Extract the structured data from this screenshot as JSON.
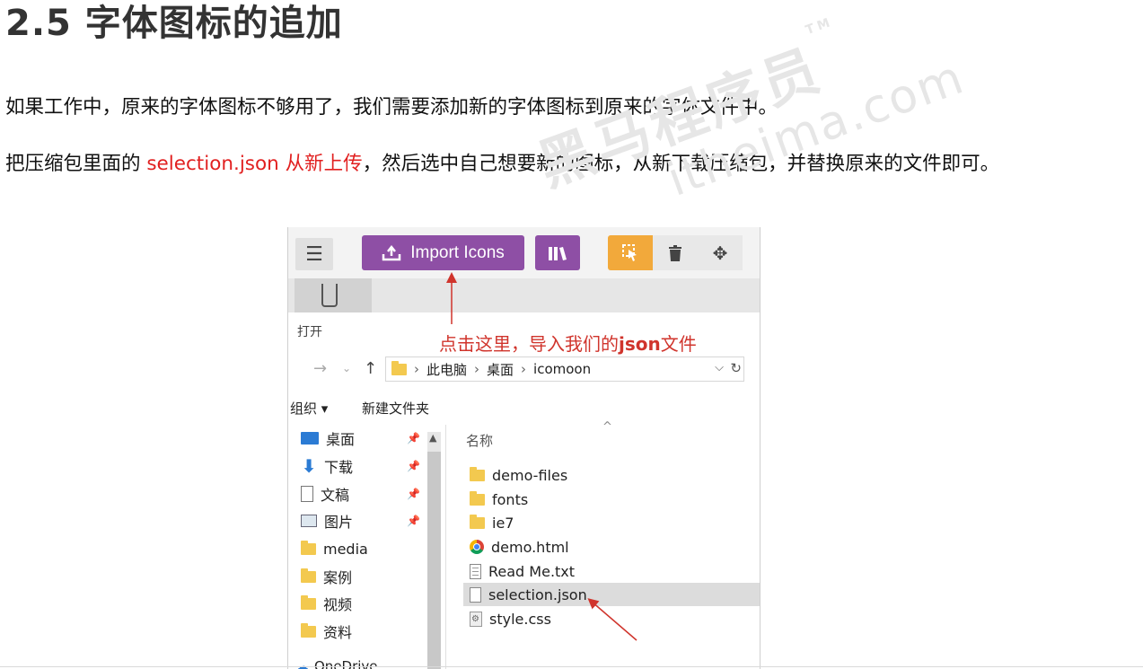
{
  "heading": "2.5 字体图标的追加",
  "para1": "如果工作中，原来的字体图标不够用了，我们需要添加新的字体图标到原来的字体文件中。",
  "para2": {
    "before": "把压缩包里面的",
    "highlight": "selection.json 从新上传",
    "after": "，然后选中自己想要新的图标，从新下载压缩包，并替换原来的文件即可。"
  },
  "watermark": {
    "main": "黑马程序员",
    "sub": "itheima.com",
    "tm": "TM"
  },
  "screenshot": {
    "toolbar": {
      "menu_icon": "hamburger-icon",
      "import_label": "Import Icons",
      "import_icon": "upload-icon",
      "library_icon": "library-icon",
      "tools": [
        "select-icon",
        "trash-icon",
        "move-icon"
      ]
    },
    "dialog_title": "打开",
    "annotation": {
      "text": "点击这里，导入我们的",
      "bold": "json",
      "tail": "文件"
    },
    "address": {
      "crumbs": [
        "此电脑",
        "桌面",
        "icomoon"
      ]
    },
    "command_bar": {
      "organize": "组织 ▾",
      "new_folder": "新建文件夹"
    },
    "nav_items": [
      {
        "label": "桌面",
        "icon": "desktop-icon",
        "pinned": true
      },
      {
        "label": "下载",
        "icon": "download-icon",
        "pinned": true
      },
      {
        "label": "文稿",
        "icon": "document-icon",
        "pinned": true
      },
      {
        "label": "图片",
        "icon": "picture-icon",
        "pinned": true
      },
      {
        "label": "media",
        "icon": "folder-icon",
        "pinned": false
      },
      {
        "label": "案例",
        "icon": "folder-icon",
        "pinned": false
      },
      {
        "label": "视频",
        "icon": "folder-icon",
        "pinned": false
      },
      {
        "label": "资料",
        "icon": "folder-icon",
        "pinned": false
      }
    ],
    "onedrive": "OneDrive",
    "column_header": "名称",
    "files": [
      {
        "name": "demo-files",
        "type": "folder"
      },
      {
        "name": "fonts",
        "type": "folder"
      },
      {
        "name": "ie7",
        "type": "folder"
      },
      {
        "name": "demo.html",
        "type": "chrome"
      },
      {
        "name": "Read Me.txt",
        "type": "txt"
      },
      {
        "name": "selection.json",
        "type": "json",
        "selected": true
      },
      {
        "name": "style.css",
        "type": "css"
      }
    ]
  },
  "colors": {
    "accent_red": "#e12020",
    "icomoon_purple": "#8e4fa5",
    "tool_orange": "#f2a93b"
  }
}
